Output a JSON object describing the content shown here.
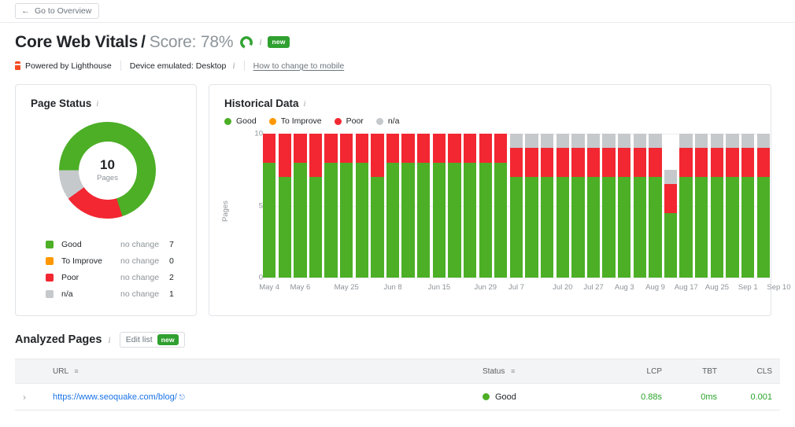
{
  "topbar": {
    "overview_button": "Go to Overview",
    "back_arrow_icon": "arrow-left-icon"
  },
  "header": {
    "title_main": "Core Web Vitals",
    "separator": "/",
    "score_text": "Score: 78%",
    "score_percent": 78,
    "ring_icon": "progress-ring-icon",
    "info_icon": "info-icon",
    "new_badge": "new"
  },
  "meta": {
    "lighthouse_icon": "lighthouse-icon",
    "powered_by": "Powered by Lighthouse",
    "device": "Device emulated: Desktop",
    "device_info_icon": "info-icon",
    "change_link": "How to change to mobile"
  },
  "page_status": {
    "title": "Page Status",
    "info_icon": "info-icon",
    "center_value": "10",
    "center_label": "Pages",
    "legend": [
      {
        "label": "Good",
        "change": "no change",
        "value": "7",
        "color": "#4caf26"
      },
      {
        "label": "To Improve",
        "change": "no change",
        "value": "0",
        "color": "#ff9800"
      },
      {
        "label": "Poor",
        "change": "no change",
        "value": "2",
        "color": "#f22732"
      },
      {
        "label": "n/a",
        "change": "no change",
        "value": "1",
        "color": "#c6c9cc"
      }
    ]
  },
  "historical": {
    "title": "Historical Data",
    "info_icon": "info-icon",
    "legend": [
      {
        "label": "Good",
        "color": "#4caf26"
      },
      {
        "label": "To Improve",
        "color": "#ff9800"
      },
      {
        "label": "Poor",
        "color": "#f22732"
      },
      {
        "label": "n/a",
        "color": "#c6c9cc"
      }
    ]
  },
  "chart_data": {
    "type": "bar",
    "stacked": true,
    "title": "Historical Data",
    "xlabel": "",
    "ylabel": "Pages",
    "ylim": [
      0,
      10
    ],
    "yticks": [
      0,
      5,
      10
    ],
    "grid": true,
    "legend_position": "top",
    "series": [
      {
        "name": "Good",
        "color": "#4caf26",
        "values": [
          8,
          7,
          8,
          7,
          8,
          8,
          8,
          7,
          8,
          8,
          8,
          8,
          8,
          8,
          8,
          8,
          7,
          7,
          7,
          7,
          7,
          7,
          7,
          7,
          7,
          7,
          4.5,
          7,
          7,
          7,
          7,
          7,
          7
        ]
      },
      {
        "name": "To Improve",
        "color": "#ff9800",
        "values": [
          0,
          0,
          0,
          0,
          0,
          0,
          0,
          0,
          0,
          0,
          0,
          0,
          0,
          0,
          0,
          0,
          0,
          0,
          0,
          0,
          0,
          0,
          0,
          0,
          0,
          0,
          0,
          0,
          0,
          0,
          0,
          0,
          0
        ]
      },
      {
        "name": "Poor",
        "color": "#f22732",
        "values": [
          2,
          3,
          2,
          3,
          2,
          2,
          2,
          3,
          2,
          2,
          2,
          2,
          2,
          2,
          2,
          2,
          2,
          2,
          2,
          2,
          2,
          2,
          2,
          2,
          2,
          2,
          2,
          2,
          2,
          2,
          2,
          2,
          2
        ]
      },
      {
        "name": "n/a",
        "color": "#c6c9cc",
        "values": [
          0,
          0,
          0,
          0,
          0,
          0,
          0,
          0,
          0,
          0,
          0,
          0,
          0,
          0,
          0,
          0,
          1,
          1,
          1,
          1,
          1,
          1,
          1,
          1,
          1,
          1,
          1,
          1,
          1,
          1,
          1,
          1,
          1
        ]
      }
    ],
    "x_tick_labels": [
      {
        "index": 1,
        "label": "May 4"
      },
      {
        "index": 3,
        "label": "May 6"
      },
      {
        "index": 6,
        "label": "May 25"
      },
      {
        "index": 9,
        "label": "Jun 8"
      },
      {
        "index": 12,
        "label": "Jun 15"
      },
      {
        "index": 15,
        "label": "Jun 29"
      },
      {
        "index": 17,
        "label": "Jul 7"
      },
      {
        "index": 20,
        "label": "Jul 20"
      },
      {
        "index": 22,
        "label": "Jul 27"
      },
      {
        "index": 24,
        "label": "Aug 3"
      },
      {
        "index": 26,
        "label": "Aug 9"
      },
      {
        "index": 28,
        "label": "Aug 17"
      },
      {
        "index": 30,
        "label": "Aug 25"
      },
      {
        "index": 32,
        "label": "Sep 1"
      },
      {
        "index": 34,
        "label": "Sep 10"
      }
    ]
  },
  "analyzed": {
    "title": "Analyzed Pages",
    "info_icon": "info-icon",
    "edit_button": "Edit list",
    "edit_badge": "new",
    "columns": {
      "url": "URL",
      "status": "Status",
      "lcp": "LCP",
      "tbt": "TBT",
      "cls": "CLS"
    },
    "rows": [
      {
        "expand_icon": "chevron-right-icon",
        "url": "https://www.seoquake.com/blog/",
        "external_icon": "external-link-icon",
        "status": "Good",
        "status_color": "#4caf26",
        "lcp": "0.88s",
        "tbt": "0ms",
        "cls": "0.001"
      }
    ]
  }
}
